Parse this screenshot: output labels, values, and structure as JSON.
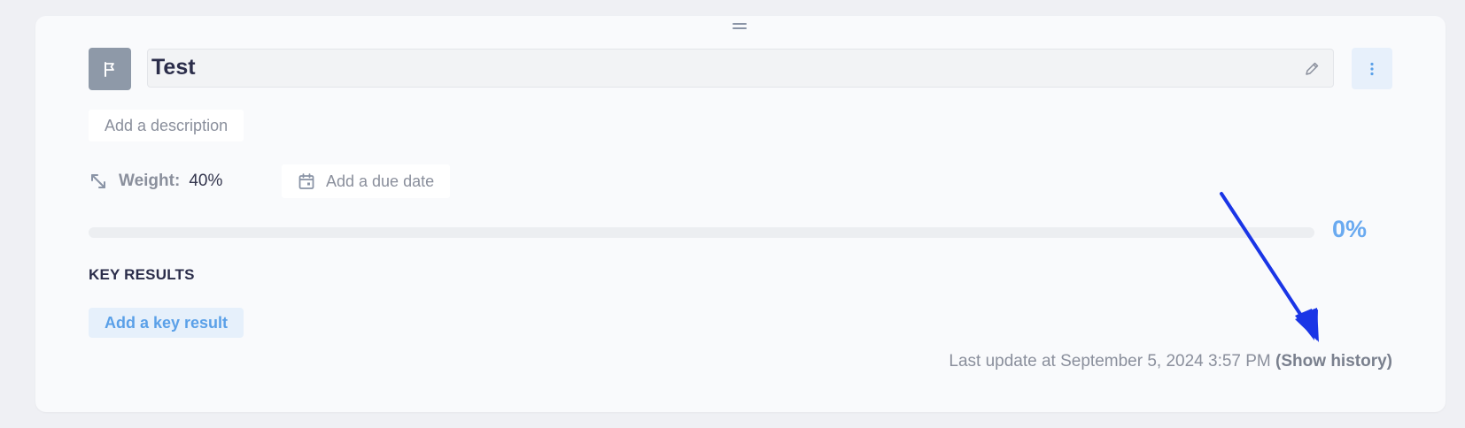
{
  "objective": {
    "title": "Test",
    "description_placeholder": "Add a description",
    "weight_label": "Weight:",
    "weight_value": "40%",
    "due_date_placeholder": "Add a due date",
    "progress": 0,
    "progress_label": "0%"
  },
  "key_results": {
    "heading": "KEY RESULTS",
    "add_label": "Add a key result"
  },
  "footer": {
    "last_update_text": "Last update at September 5, 2024 3:57 PM",
    "show_history_label": "(Show history)"
  },
  "icons": {
    "drag": "drag-handle-icon",
    "flag": "flag-icon",
    "edit": "pencil-icon",
    "more": "kebab-menu-icon",
    "weight": "resize-arrows-icon",
    "calendar": "calendar-icon"
  },
  "colors": {
    "accent": "#5aa0e8",
    "annotation_arrow": "#1a35e6"
  }
}
